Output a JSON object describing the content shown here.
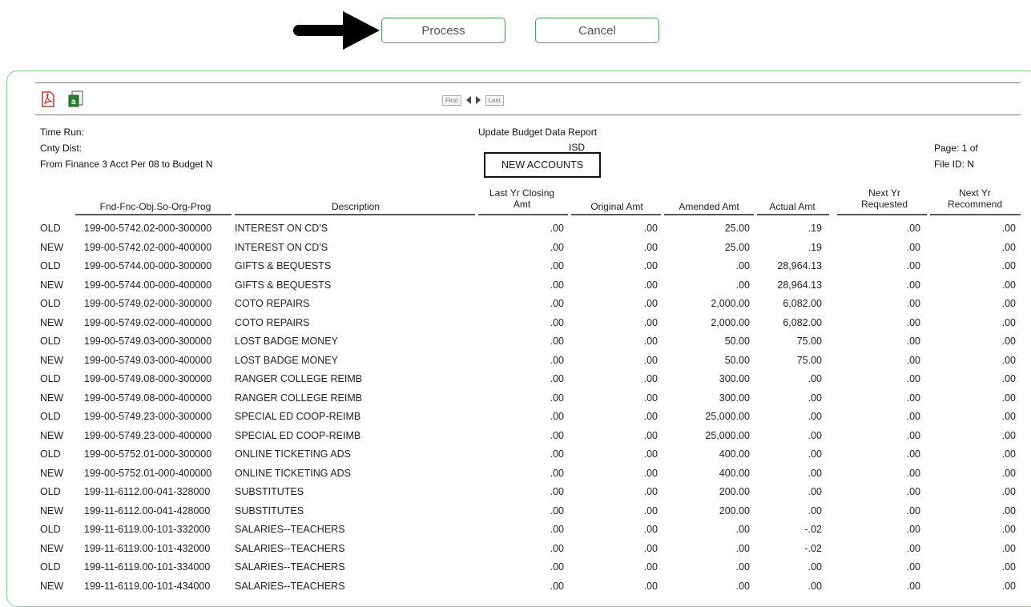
{
  "toolbar": {
    "process_label": "Process",
    "cancel_label": "Cancel"
  },
  "pager": {
    "first_label": "First",
    "last_label": "Last"
  },
  "report_header": {
    "time_run_label": "Time Run:",
    "cnty_dist_label": "Cnty Dist:",
    "from_label": "From Finance 3 Acct Per 08 to Budget N",
    "title": "Update Budget Data Report",
    "isd": "ISD",
    "section": "NEW ACCOUNTS",
    "page_label": "Page: 1   of",
    "file_id": "File ID: N"
  },
  "columns": {
    "acct": "Fnd-Fnc-Obj.So-Org-Prog",
    "desc": "Description",
    "last_yr": "Last Yr  Closing Amt",
    "original": "Original Amt",
    "amended": "Amended Amt",
    "actual": "Actual Amt",
    "next_req": "Next Yr Requested",
    "next_rec": "Next Yr Recommend"
  },
  "rows": [
    {
      "flag": "OLD",
      "acct": "199-00-5742.02-000-300000",
      "desc": "INTEREST ON CD'S",
      "ly": ".00",
      "orig": ".00",
      "amend": "25.00",
      "act": ".19",
      "req": ".00",
      "rec": ".00"
    },
    {
      "flag": "NEW",
      "acct": "199-00-5742.02-000-400000",
      "desc": "INTEREST ON CD'S",
      "ly": ".00",
      "orig": ".00",
      "amend": "25.00",
      "act": ".19",
      "req": ".00",
      "rec": ".00"
    },
    {
      "flag": "OLD",
      "acct": "199-00-5744.00-000-300000",
      "desc": "GIFTS & BEQUESTS",
      "ly": ".00",
      "orig": ".00",
      "amend": ".00",
      "act": "28,964.13",
      "req": ".00",
      "rec": ".00"
    },
    {
      "flag": "NEW",
      "acct": "199-00-5744.00-000-400000",
      "desc": "GIFTS & BEQUESTS",
      "ly": ".00",
      "orig": ".00",
      "amend": ".00",
      "act": "28,964.13",
      "req": ".00",
      "rec": ".00"
    },
    {
      "flag": "OLD",
      "acct": "199-00-5749.02-000-300000",
      "desc": "COTO REPAIRS",
      "ly": ".00",
      "orig": ".00",
      "amend": "2,000.00",
      "act": "6,082.00",
      "req": ".00",
      "rec": ".00"
    },
    {
      "flag": "NEW",
      "acct": "199-00-5749.02-000-400000",
      "desc": "COTO REPAIRS",
      "ly": ".00",
      "orig": ".00",
      "amend": "2,000.00",
      "act": "6,082.00",
      "req": ".00",
      "rec": ".00"
    },
    {
      "flag": "OLD",
      "acct": "199-00-5749.03-000-300000",
      "desc": "LOST BADGE MONEY",
      "ly": ".00",
      "orig": ".00",
      "amend": "50.00",
      "act": "75.00",
      "req": ".00",
      "rec": ".00"
    },
    {
      "flag": "NEW",
      "acct": "199-00-5749.03-000-400000",
      "desc": "LOST BADGE MONEY",
      "ly": ".00",
      "orig": ".00",
      "amend": "50.00",
      "act": "75.00",
      "req": ".00",
      "rec": ".00"
    },
    {
      "flag": "OLD",
      "acct": "199-00-5749.08-000-300000",
      "desc": "RANGER COLLEGE REIMB",
      "ly": ".00",
      "orig": ".00",
      "amend": "300.00",
      "act": ".00",
      "req": ".00",
      "rec": ".00"
    },
    {
      "flag": "NEW",
      "acct": "199-00-5749.08-000-400000",
      "desc": "RANGER COLLEGE REIMB",
      "ly": ".00",
      "orig": ".00",
      "amend": "300.00",
      "act": ".00",
      "req": ".00",
      "rec": ".00"
    },
    {
      "flag": "OLD",
      "acct": "199-00-5749.23-000-300000",
      "desc": "SPECIAL ED COOP-REIMB",
      "ly": ".00",
      "orig": ".00",
      "amend": "25,000.00",
      "act": ".00",
      "req": ".00",
      "rec": ".00"
    },
    {
      "flag": "NEW",
      "acct": "199-00-5749.23-000-400000",
      "desc": "SPECIAL ED COOP-REIMB",
      "ly": ".00",
      "orig": ".00",
      "amend": "25,000.00",
      "act": ".00",
      "req": ".00",
      "rec": ".00"
    },
    {
      "flag": "OLD",
      "acct": "199-00-5752.01-000-300000",
      "desc": "ONLINE TICKETING ADS",
      "ly": ".00",
      "orig": ".00",
      "amend": "400.00",
      "act": ".00",
      "req": ".00",
      "rec": ".00"
    },
    {
      "flag": "NEW",
      "acct": "199-00-5752.01-000-400000",
      "desc": "ONLINE TICKETING ADS",
      "ly": ".00",
      "orig": ".00",
      "amend": "400.00",
      "act": ".00",
      "req": ".00",
      "rec": ".00"
    },
    {
      "flag": "OLD",
      "acct": "199-11-6112.00-041-328000",
      "desc": "SUBSTITUTES",
      "ly": ".00",
      "orig": ".00",
      "amend": "200.00",
      "act": ".00",
      "req": ".00",
      "rec": ".00"
    },
    {
      "flag": "NEW",
      "acct": "199-11-6112.00-041-428000",
      "desc": "SUBSTITUTES",
      "ly": ".00",
      "orig": ".00",
      "amend": "200.00",
      "act": ".00",
      "req": ".00",
      "rec": ".00"
    },
    {
      "flag": "OLD",
      "acct": "199-11-6119.00-101-332000",
      "desc": "SALARIES--TEACHERS",
      "ly": ".00",
      "orig": ".00",
      "amend": ".00",
      "act": "-.02",
      "req": ".00",
      "rec": ".00"
    },
    {
      "flag": "NEW",
      "acct": "199-11-6119.00-101-432000",
      "desc": "SALARIES--TEACHERS",
      "ly": ".00",
      "orig": ".00",
      "amend": ".00",
      "act": "-.02",
      "req": ".00",
      "rec": ".00"
    },
    {
      "flag": "OLD",
      "acct": "199-11-6119.00-101-334000",
      "desc": "SALARIES--TEACHERS",
      "ly": ".00",
      "orig": ".00",
      "amend": ".00",
      "act": ".00",
      "req": ".00",
      "rec": ".00"
    },
    {
      "flag": "NEW",
      "acct": "199-11-6119.00-101-434000",
      "desc": "SALARIES--TEACHERS",
      "ly": ".00",
      "orig": ".00",
      "amend": ".00",
      "act": ".00",
      "req": ".00",
      "rec": ".00"
    }
  ]
}
